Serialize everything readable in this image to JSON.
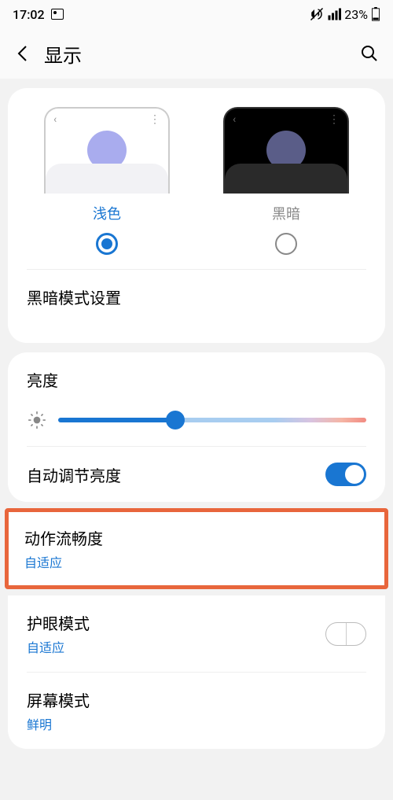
{
  "status": {
    "time": "17:02",
    "battery": "23%"
  },
  "header": {
    "title": "显示"
  },
  "theme": {
    "light_label": "浅色",
    "dark_label": "黑暗"
  },
  "dark_mode_settings": "黑暗模式设置",
  "brightness": {
    "label": "亮度",
    "value_percent": 38
  },
  "auto_brightness": {
    "label": "自动调节亮度",
    "enabled": true
  },
  "motion_smoothness": {
    "label": "动作流畅度",
    "value": "自适应"
  },
  "eye_comfort": {
    "label": "护眼模式",
    "value": "自适应"
  },
  "screen_mode": {
    "label": "屏幕模式",
    "value": "鲜明"
  }
}
